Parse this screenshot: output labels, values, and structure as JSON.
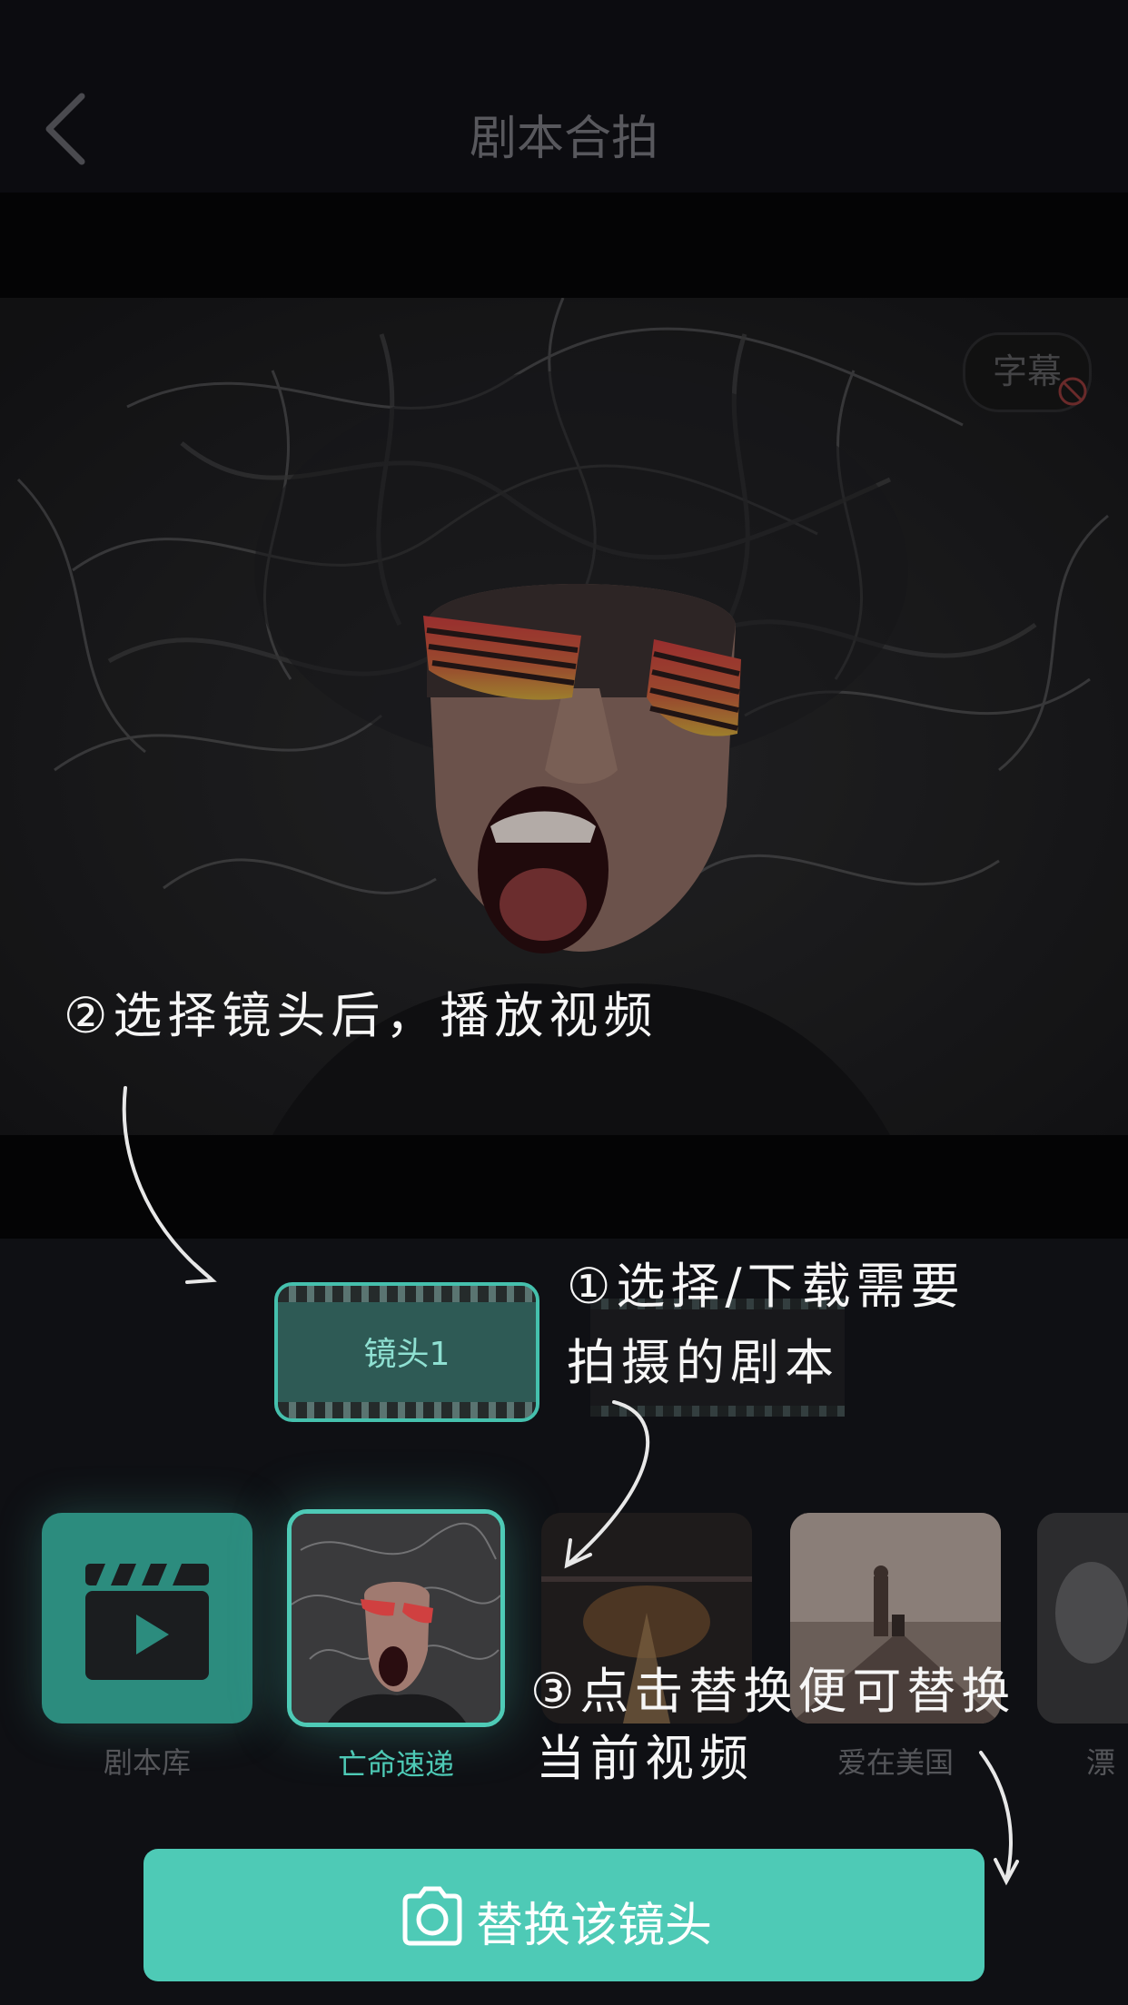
{
  "header": {
    "title": "剧本合拍"
  },
  "video": {
    "subtitle_toggle": "字幕"
  },
  "shot": {
    "label": "镜头1",
    "ghost_label": ""
  },
  "scripts": [
    {
      "label": "剧本库",
      "type": "library"
    },
    {
      "label": "亡命速递",
      "type": "selected"
    },
    {
      "label": "",
      "type": "station"
    },
    {
      "label": "爱在美国",
      "type": "rail"
    },
    {
      "label": "漂",
      "type": "portrait"
    }
  ],
  "actions": {
    "replace_label": "替换该镜头"
  },
  "annotations": {
    "step2": "②选择镜头后，播放视频",
    "step1_line1": "①选择/下载需要",
    "step1_line2": "拍摄的剧本",
    "step3_line1": "③点击替换便可替换",
    "step3_line2": "当前视频"
  },
  "colors": {
    "accent": "#4ecab6",
    "background": "#0d0d12"
  }
}
